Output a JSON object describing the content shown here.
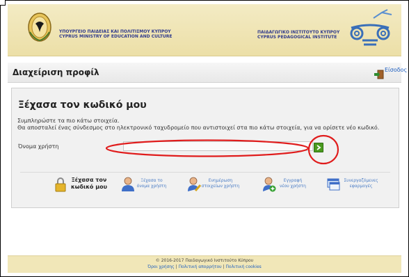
{
  "header": {
    "moe_line1": "ΥΠΟΥΡΓΕΙΟ ΠΑΙΔΕΙΑΣ ΚΑΙ ΠΟΛΙΤΙΣΜΟΥ ΚΥΠΡΟΥ",
    "moe_line2": "CYPRUS MINISTRY OF EDUCATION AND CULTURE",
    "cpi_line1": "ΠΑΙΔΑΓΩΓΙΚΟ ΙΝΣΤΙΤΟΥΤΟ ΚΥΠΡΟΥ",
    "cpi_line2": "CYPRUS PEDAGOGICAL INSTITUTE",
    "moe_emblem_icon": "cyprus-emblem-icon",
    "cpi_logo_icon": "ionic-column-logo-icon"
  },
  "profile_bar": {
    "title": "Διαχείριση προφίλ",
    "login_label": "Είσοδος",
    "login_icon": "door-login-icon"
  },
  "form": {
    "title": "Ξέχασα τον κωδικό μου",
    "intro_line1": "Συμπληρώστε τα πιο κάτω στοιχεία.",
    "intro_line2": "Θα αποσταλεί ένας σύνδεσμος στο ηλεκτρονικό ταχυδρομείο που αντιστοιχεί στα πιο κάτω στοιχεία, για να ορίσετε νέο κωδικό.",
    "username_label": "Όνομα χρήστη",
    "username_value": "",
    "submit_icon": "arrow-right-icon"
  },
  "options": [
    {
      "line1": "Ξέχασα τον",
      "line2": "κωδικό μου",
      "icon": "lock-icon",
      "active": true
    },
    {
      "line1": "Ξέχασα το",
      "line2": "όνομα χρήστη",
      "icon": "user-icon",
      "active": false
    },
    {
      "line1": "Ενημέρωση",
      "line2": "στοιχείων χρήστη",
      "icon": "user-edit-icon",
      "active": false
    },
    {
      "line1": "Εγγραφή",
      "line2": "νέου χρήστη",
      "icon": "user-add-icon",
      "active": false
    },
    {
      "line1": "Συνεργαζόμενες",
      "line2": "εφαρμογές",
      "icon": "windows-icon",
      "active": false
    }
  ],
  "footer": {
    "copyright": "© 2016-2017 Παιδαγωγικό Ινστιτούτο Κύπρου",
    "links": [
      "Όροι χρήσης",
      "Πολιτική απορρήτου",
      "Πολιτική cookies"
    ],
    "separator": "|"
  },
  "colors": {
    "header_bg": "#ecdfa7",
    "brand_text": "#2f3a8c",
    "link": "#1f5fbf",
    "annotation": "#e01c1c",
    "go_button": "#4a9a1e"
  }
}
